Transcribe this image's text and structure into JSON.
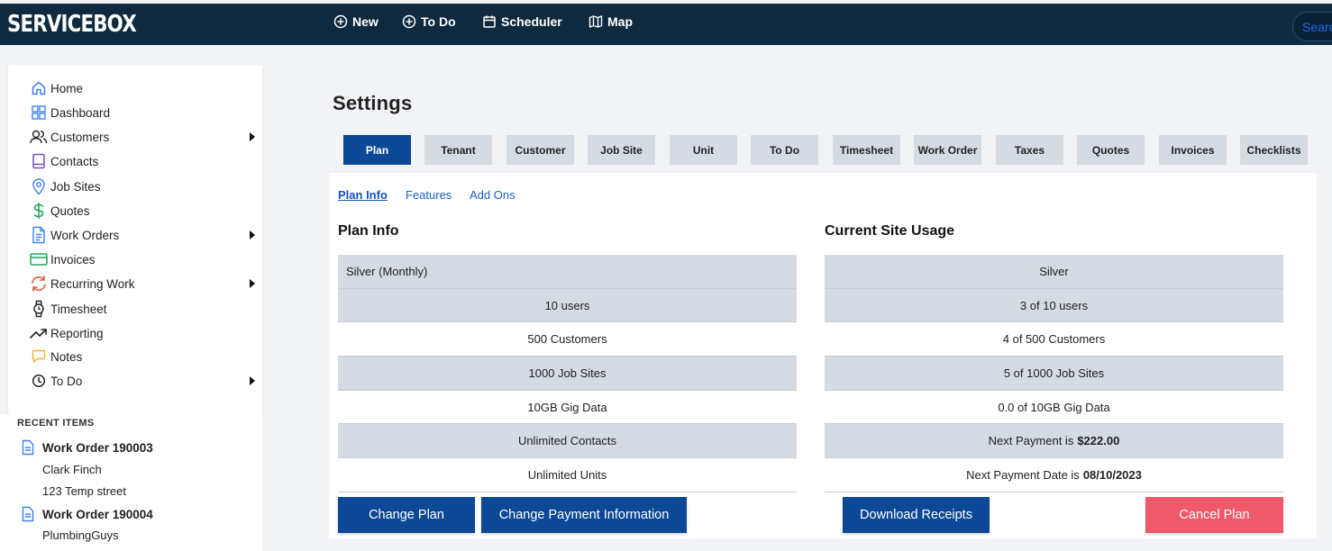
{
  "app": {
    "logo": "SERVICEBOX",
    "nav": [
      {
        "label": "New",
        "icon": "plus-circle-icon"
      },
      {
        "label": "To Do",
        "icon": "plus-circle-icon"
      },
      {
        "label": "Scheduler",
        "icon": "calendar-icon"
      },
      {
        "label": "Map",
        "icon": "map-icon"
      }
    ],
    "search_placeholder": "Search"
  },
  "sidebar": {
    "items": [
      {
        "label": "Home",
        "icon": "home-icon",
        "color": "#3b82f6"
      },
      {
        "label": "Dashboard",
        "icon": "dashboard-icon",
        "color": "#3b82f6"
      },
      {
        "label": "Customers",
        "icon": "users-icon",
        "color": "#222222",
        "submenu": true
      },
      {
        "label": "Contacts",
        "icon": "contact-book-icon",
        "color": "#7c4dcc"
      },
      {
        "label": "Job Sites",
        "icon": "location-pin-icon",
        "color": "#3b82f6"
      },
      {
        "label": "Quotes",
        "icon": "dollar-icon",
        "color": "#22a35b"
      },
      {
        "label": "Work Orders",
        "icon": "document-icon",
        "color": "#3b82f6",
        "submenu": true
      },
      {
        "label": "Invoices",
        "icon": "credit-card-icon",
        "color": "#22a35b"
      },
      {
        "label": "Recurring Work",
        "icon": "refresh-icon",
        "color": "#e8553a",
        "submenu": true
      },
      {
        "label": "Timesheet",
        "icon": "watch-icon",
        "color": "#222222"
      },
      {
        "label": "Reporting",
        "icon": "trending-up-icon",
        "color": "#222222"
      },
      {
        "label": "Notes",
        "icon": "note-icon",
        "color": "#f2b533"
      },
      {
        "label": "To Do",
        "icon": "clock-icon",
        "color": "#222222",
        "submenu": true
      }
    ]
  },
  "recent": {
    "title": "RECENT ITEMS",
    "items": [
      {
        "title": "Work Order 190003",
        "lines": [
          "Clark Finch",
          "123 Temp street"
        ]
      },
      {
        "title": "Work Order 190004",
        "lines": [
          "PlumbingGuys"
        ]
      }
    ]
  },
  "main": {
    "title": "Settings",
    "tabs": [
      "Plan",
      "Tenant",
      "Customer",
      "Job Site",
      "Unit",
      "To Do",
      "Timesheet",
      "Work Order",
      "Taxes",
      "Quotes",
      "Invoices",
      "Checklists"
    ],
    "active_tab": "Plan",
    "subtabs": [
      "Plan Info",
      "Features",
      "Add Ons"
    ],
    "active_subtab": "Plan Info",
    "plan_info": {
      "title": "Plan Info",
      "rows": [
        "Silver (Monthly)",
        "10 users",
        "500 Customers",
        "1000 Job Sites",
        "10GB Gig Data",
        "Unlimited Contacts",
        "Unlimited Units"
      ]
    },
    "usage": {
      "title": "Current Site Usage",
      "rows": [
        "Silver",
        "3 of 10 users",
        "4 of 500 Customers",
        "5 of 1000 Job Sites",
        "0.0 of 10GB Gig Data"
      ],
      "next_payment_label": "Next Payment is",
      "next_payment_value": "$222.00",
      "next_payment_date_label": "Next Payment Date is",
      "next_payment_date_value": "08/10/2023"
    },
    "buttons": {
      "change_plan": "Change Plan",
      "change_payment": "Change Payment Information",
      "download_receipts": "Download Receipts",
      "cancel_plan": "Cancel Plan"
    }
  }
}
